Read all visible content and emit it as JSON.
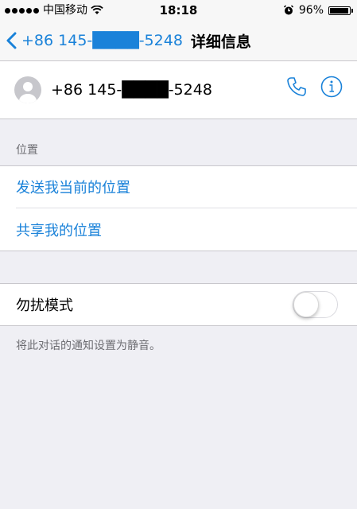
{
  "status_bar": {
    "carrier": "中国移动",
    "time": "18:18",
    "battery": "96%",
    "battery_level": 0.96
  },
  "nav": {
    "back_label": "+86 145-████-5248",
    "title": "详细信息"
  },
  "contact": {
    "name": "+86 145-████-5248",
    "icons": [
      "phone-icon",
      "info-icon"
    ]
  },
  "location_section": {
    "header": "位置",
    "send_current": "发送我当前的位置",
    "share": "共享我的位置"
  },
  "dnd": {
    "label": "勿扰模式",
    "enabled": false,
    "footnote": "将此对话的通知设置为静音。"
  },
  "colors": {
    "accent": "#1a82d9",
    "background": "#efeff4"
  }
}
